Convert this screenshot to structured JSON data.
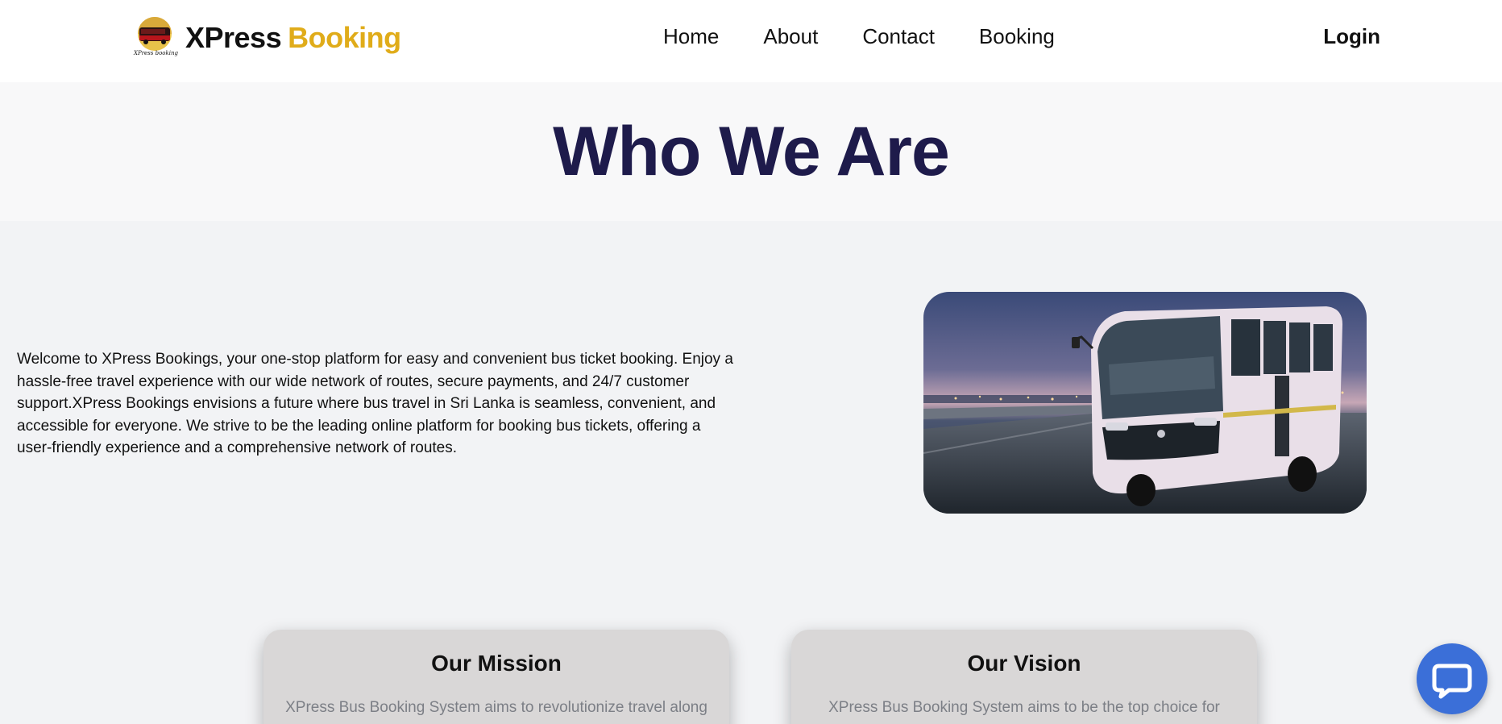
{
  "brand": {
    "name_part1": "XPress",
    "name_part2": "Booking",
    "badge_caption": "XPress booking",
    "accent": "#e0ac1a"
  },
  "nav": {
    "items": [
      "Home",
      "About",
      "Contact",
      "Booking"
    ],
    "login_label": "Login"
  },
  "hero": {
    "title": "Who We Are",
    "title_color": "#1e1b4b"
  },
  "intro": {
    "text": "Welcome to XPress Bookings, your one-stop platform for easy and convenient bus ticket booking. Enjoy a hassle-free travel experience with our wide network of routes, secure payments, and 24/7 customer support.XPress Bookings envisions a future where bus travel in Sri Lanka is seamless, convenient, and accessible for everyone. We strive to be the leading online platform for booking bus tickets, offering a user-friendly experience and a comprehensive network of routes.",
    "image": "bus-photo"
  },
  "cards": {
    "mission": {
      "title": "Our Mission",
      "text": "XPress Bus Booking System aims to revolutionize travel along"
    },
    "vision": {
      "title": "Our Vision",
      "text": "XPress Bus Booking System aims to be the top choice for"
    }
  },
  "chat": {
    "icon": "chat-bubble-icon",
    "color": "#3b6fd8"
  }
}
